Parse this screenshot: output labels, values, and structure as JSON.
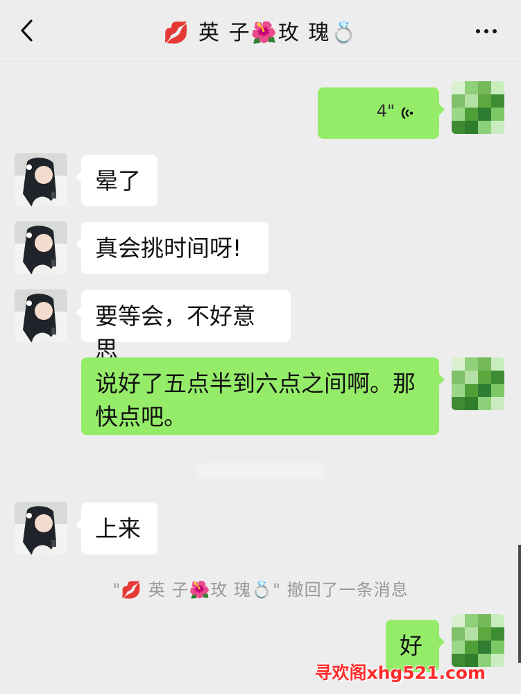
{
  "header": {
    "title": "💋 英 子🌺玫 瑰💍"
  },
  "messages": [
    {
      "type": "voice",
      "duration": "4\""
    },
    {
      "text": "晕了"
    },
    {
      "text": "真会挑时间呀!"
    },
    {
      "text": "要等会，不好意思"
    },
    {
      "text": "说好了五点半到六点之间啊。那快点吧。"
    },
    {
      "text": "上来"
    },
    {
      "text": "好"
    }
  ],
  "system_message": "\"💋 英 子🌺玫 瑰💍\" 撤回了一条消息",
  "watermark": "寻欢阁xhg521.com",
  "colors": {
    "background": "#ededed",
    "left_bubble": "#ffffff",
    "right_bubble": "#95ec69"
  },
  "icons": {
    "back": "chevron-left-icon",
    "more": "more-icon",
    "voice": "voice-icon"
  }
}
